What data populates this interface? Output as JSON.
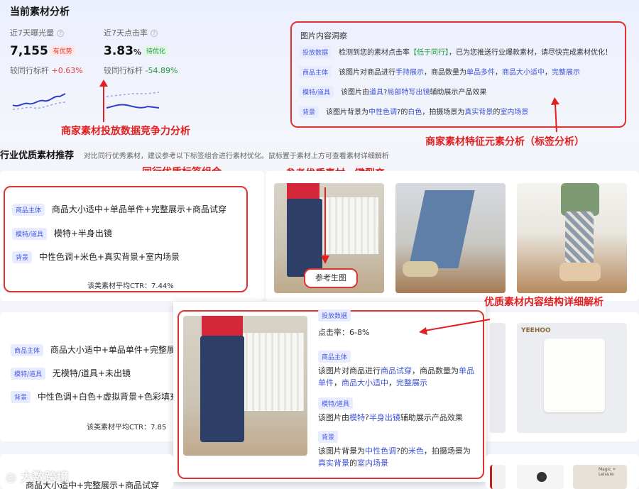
{
  "page_title": "当前素材分析",
  "metrics": [
    {
      "label": "近7天曝光量",
      "value": "7,155",
      "badge": "有优势",
      "bench_label": "较同行标杆",
      "bench_value": "+0.63%"
    },
    {
      "label": "近7天点击率",
      "value": "3.83",
      "unit": "%",
      "badge": "待优化",
      "bench_label": "较同行标杆",
      "bench_value": "-54.89%"
    }
  ],
  "insight": {
    "title": "图片内容洞察",
    "rows": [
      {
        "tag": "投放数据",
        "segs": [
          {
            "t": "检测到您的素材点击率"
          },
          {
            "t": "【低于同行】",
            "c": "green"
          },
          {
            "t": "，已为您推送行业爆款素材，请尽快完成素材优化！"
          }
        ]
      },
      {
        "tag": "商品主体",
        "segs": [
          {
            "t": "该图片对商品进行"
          },
          {
            "t": "手持展示",
            "c": "link"
          },
          {
            "t": "，商品数量为"
          },
          {
            "t": "单品多件",
            "c": "link"
          },
          {
            "t": "，"
          },
          {
            "t": "商品大小适中",
            "c": "link"
          },
          {
            "t": "，"
          },
          {
            "t": "完整展示",
            "c": "link"
          }
        ]
      },
      {
        "tag": "模特/道具",
        "segs": [
          {
            "t": "该图片由"
          },
          {
            "t": "道具",
            "c": "link"
          },
          {
            "t": "?"
          },
          {
            "t": "局部特写出镜",
            "c": "link"
          },
          {
            "t": "辅助展示产品效果"
          }
        ]
      },
      {
        "tag": "背景",
        "segs": [
          {
            "t": "该图片背景为"
          },
          {
            "t": "中性色调",
            "c": "link"
          },
          {
            "t": "?的"
          },
          {
            "t": "白色",
            "c": "link"
          },
          {
            "t": "，拍摄场景为"
          },
          {
            "t": "真实背景",
            "c": "link"
          },
          {
            "t": "的"
          },
          {
            "t": "室内场景",
            "c": "link"
          }
        ]
      }
    ]
  },
  "annotations": {
    "competitiveness": "商家素材投放数据竞争力分析",
    "tag_analysis": "商家素材特征元素分析（标签分析）",
    "peer_tags": "同行优质标签组合",
    "one_click": "参考优质素材一键裂变",
    "detail": "优质素材内容结构详细解析"
  },
  "industry": {
    "title": "行业优质素材推荐",
    "subtitle": "对比同行优秀素材，建议参考以下标签组合进行素材优化。鼠标置于素材上方可查看素材详细解析"
  },
  "group1": {
    "rows": [
      {
        "tag": "商品主体",
        "text": "商品大小适中+单品单件+完整展示+商品试穿"
      },
      {
        "tag": "模特/道具",
        "text": "模特+半身出镜"
      },
      {
        "tag": "背景",
        "text": "中性色调+米色+真实背景+室内场景"
      }
    ],
    "ctr": "该类素材平均CTR：7.44%"
  },
  "group2": {
    "rows": [
      {
        "tag": "商品主体",
        "text": "商品大小适中+单品单件+完整展"
      },
      {
        "tag": "模特/道具",
        "text": "无模特/道具+未出镜"
      },
      {
        "tag": "背景",
        "text": "中性色调+白色+虚拟背景+色彩填充"
      }
    ],
    "ctr": "该类素材平均CTR：7.85"
  },
  "group3_partial": "商品大小适中+完整展示+商品试穿",
  "ref_button": "参考生图",
  "popover": {
    "tag1": "投放数据",
    "ctr": "点击率：6-8%",
    "tag2": "商品主体",
    "line2": [
      {
        "t": "该图片对商品进行"
      },
      {
        "t": "商品试穿",
        "c": "link"
      },
      {
        "t": "，商品数量为"
      },
      {
        "t": "单品单件",
        "c": "link"
      },
      {
        "t": "，"
      },
      {
        "t": "商品大小适中",
        "c": "link"
      },
      {
        "t": "，"
      },
      {
        "t": "完整展示",
        "c": "link"
      }
    ],
    "tag3": "模特/道具",
    "line3": [
      {
        "t": "该图片由"
      },
      {
        "t": "模特",
        "c": "link"
      },
      {
        "t": "?"
      },
      {
        "t": "半身出镜",
        "c": "link"
      },
      {
        "t": "辅助展示产品效果"
      }
    ],
    "tag4": "背景",
    "line4": [
      {
        "t": "该图片背景为"
      },
      {
        "t": "中性色调",
        "c": "link"
      },
      {
        "t": "?的"
      },
      {
        "t": "米色",
        "c": "link"
      },
      {
        "t": "，拍摄场景为"
      },
      {
        "t": "真实背景",
        "c": "link"
      },
      {
        "t": "的"
      },
      {
        "t": "室内场景",
        "c": "link"
      }
    ]
  },
  "brand_label": "YEEHOO",
  "small_label": "Magic + Leisure",
  "watermark": "大数跨境",
  "colors": {
    "accent": "#3d54d6",
    "annotation": "#e02020",
    "tag_bg": "#e8ecff"
  }
}
